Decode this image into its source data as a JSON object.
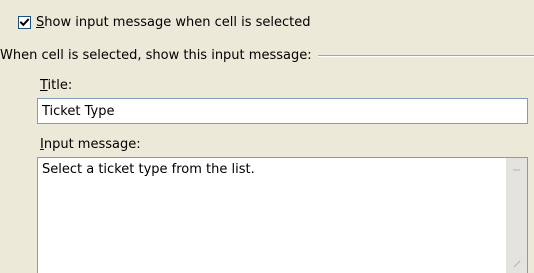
{
  "show_input_message": {
    "checked": true,
    "label_accel": "S",
    "label_rest": "how input message when cell is selected"
  },
  "group": {
    "label": "When cell is selected, show this input message:"
  },
  "title_field": {
    "label_accel": "T",
    "label_rest": "itle:",
    "value": "Ticket Type"
  },
  "message_field": {
    "label_accel": "I",
    "label_rest": "nput message:",
    "value": "Select a ticket type from the list."
  },
  "icons": {
    "check": "checkmark-icon",
    "scroll_up": "scroll-up-arrow-icon",
    "resize": "resize-grip-icon"
  }
}
